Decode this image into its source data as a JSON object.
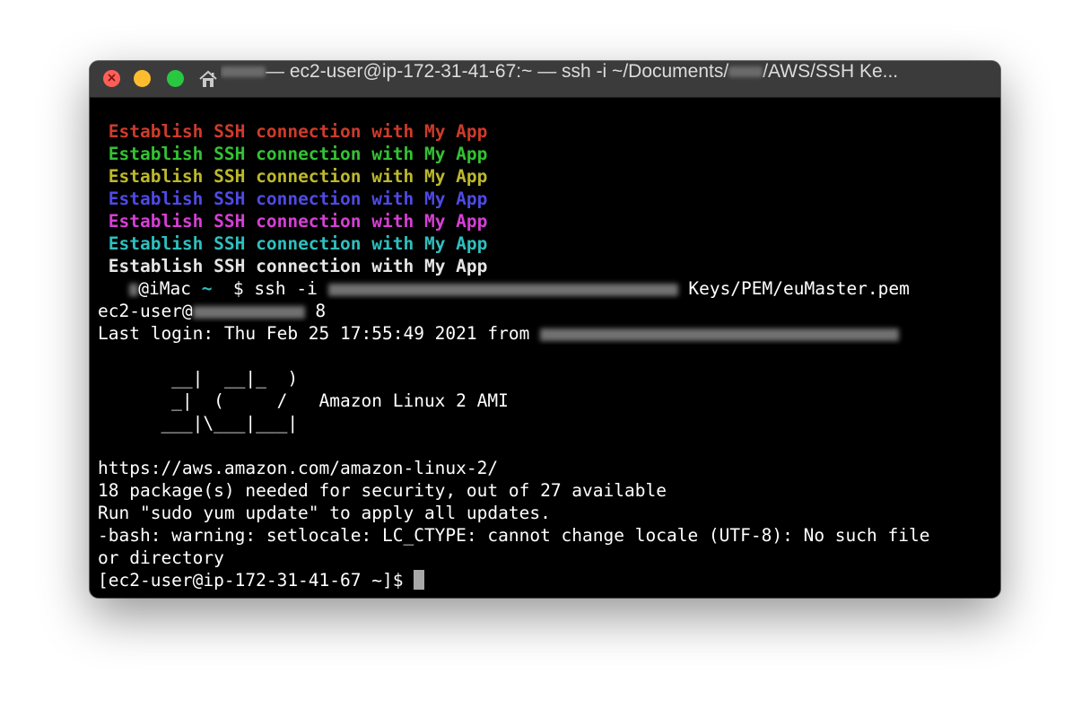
{
  "window": {
    "title": "— ec2-user@ip-172-31-41-67:~ — ssh -i ~/Documents/",
    "title_tail": "/AWS/SSH Ke..."
  },
  "banner": {
    "line": "Establish SSH connection with My App",
    "colors": [
      "#ce3b2b",
      "#33c233",
      "#bdb92c",
      "#4f4ae6",
      "#d63fd6",
      "#2fbfbf",
      "#e5e5e5"
    ]
  },
  "session": {
    "prompt_host": "@iMac",
    "prompt_tilde": "~",
    "prompt_cmd": "$ ssh -i",
    "key_path": "Keys/PEM/euMaster.pem",
    "user_at": "ec2-user@",
    "ip_suffix": "8",
    "last_login": "Last login: Thu Feb 25 17:55:49 2021 from",
    "ascii_1": "       __|  __|_  )",
    "ascii_2": "       _|  (     /   Amazon Linux 2 AMI",
    "ascii_3": "      ___|\\___|___|",
    "url": "https://aws.amazon.com/amazon-linux-2/",
    "packages": "18 package(s) needed for security, out of 27 available",
    "run_hint": "Run \"sudo yum update\" to apply all updates.",
    "warning_1": "-bash: warning: setlocale: LC_CTYPE: cannot change locale (UTF-8): No such file",
    "warning_2": "or directory",
    "final_prompt": "[ec2-user@ip-172-31-41-67 ~]$"
  }
}
